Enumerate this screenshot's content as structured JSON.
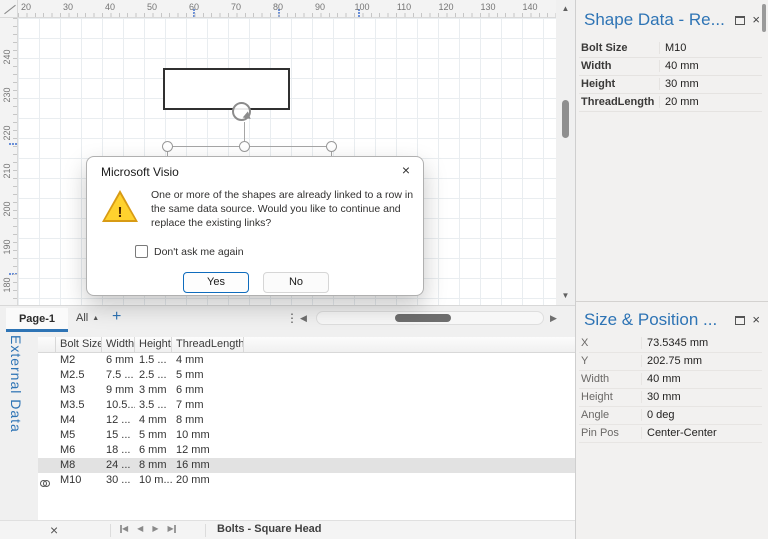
{
  "colors": {
    "accent_blue": "#2E74B5",
    "selected_row": "#e2e2e2",
    "warning_yellow": "#ffd22e",
    "yes_border": "#0F6CBD"
  },
  "icons": {
    "close": "×",
    "up_arrow": "▲",
    "down_arrow": "▼",
    "left_arrow": "◀",
    "right_arrow": "▶",
    "dots": "⋮",
    "all_caret": "▲",
    "exclamation": "!"
  },
  "canvas": {
    "h_ruler_ticks": [
      "20",
      "30",
      "40",
      "50",
      "60",
      "70",
      "80",
      "90",
      "100",
      "110",
      "120",
      "130",
      "140"
    ],
    "v_ruler_ticks": [
      "240",
      "230",
      "220",
      "210",
      "200",
      "190",
      "180"
    ]
  },
  "page_bar": {
    "page_tab": "Page-1",
    "all_label": "All",
    "add_label": "+"
  },
  "dialog": {
    "title": "Microsoft Visio",
    "message": "One or more of the shapes are already linked to a row in the same data source.  Would you like to continue and replace the existing links?",
    "checkbox_label": "Don't ask me again",
    "yes_label": "Yes",
    "no_label": "No"
  },
  "shape_data_panel": {
    "title": "Shape Data - Re...",
    "rows": [
      {
        "label": "Bolt Size",
        "value": "M10"
      },
      {
        "label": "Width",
        "value": "40 mm"
      },
      {
        "label": "Height",
        "value": "30 mm"
      },
      {
        "label": "ThreadLength",
        "value": "20 mm"
      }
    ]
  },
  "size_position_panel": {
    "title": "Size & Position ...",
    "rows": [
      {
        "label": "X",
        "value": "73.5345 mm"
      },
      {
        "label": "Y",
        "value": "202.75 mm"
      },
      {
        "label": "Width",
        "value": "40 mm"
      },
      {
        "label": "Height",
        "value": "30 mm"
      },
      {
        "label": "Angle",
        "value": "0 deg"
      },
      {
        "label": "Pin Pos",
        "value": "Center-Center"
      }
    ]
  },
  "external_data": {
    "panel_title": "External Data",
    "columns": [
      "Bolt Size",
      "Width",
      "Height",
      "ThreadLength"
    ],
    "rows": [
      {
        "linked": false,
        "selected": false,
        "cells": [
          "M2",
          "6 mm",
          "1.5 ...",
          "4 mm"
        ]
      },
      {
        "linked": false,
        "selected": false,
        "cells": [
          "M2.5",
          "7.5 ...",
          "2.5 ...",
          "5 mm"
        ]
      },
      {
        "linked": false,
        "selected": false,
        "cells": [
          "M3",
          "9 mm",
          "3 mm",
          "6 mm"
        ]
      },
      {
        "linked": false,
        "selected": false,
        "cells": [
          "M3.5",
          "10.5...",
          "3.5 ...",
          "7 mm"
        ]
      },
      {
        "linked": false,
        "selected": false,
        "cells": [
          "M4",
          "12 ...",
          "4 mm",
          "8 mm"
        ]
      },
      {
        "linked": false,
        "selected": false,
        "cells": [
          "M5",
          "15 ...",
          "5 mm",
          "10 mm"
        ]
      },
      {
        "linked": false,
        "selected": false,
        "cells": [
          "M6",
          "18 ...",
          "6 mm",
          "12 mm"
        ]
      },
      {
        "linked": false,
        "selected": true,
        "cells": [
          "M8",
          "24 ...",
          "8 mm",
          "16 mm"
        ]
      },
      {
        "linked": true,
        "selected": false,
        "cells": [
          "M10",
          "30 ...",
          "10 m...",
          "20 mm"
        ]
      }
    ],
    "source_tab": "Bolts - Square Head"
  }
}
